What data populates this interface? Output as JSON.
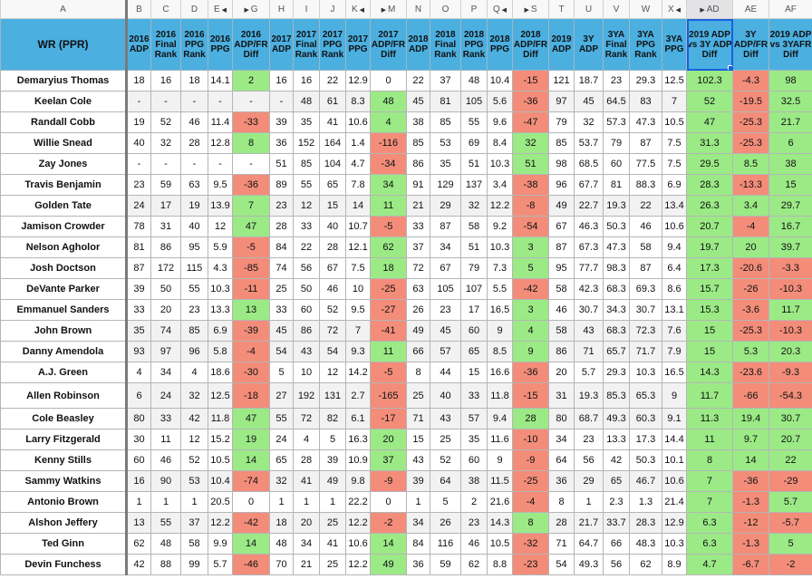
{
  "colors": {
    "header_bg": "#4bafe0",
    "positive": "#9bea86",
    "negative": "#f38d7a",
    "selection": "#1a5fe0"
  },
  "column_letters": [
    "A",
    "B",
    "C",
    "D",
    "E",
    "G",
    "H",
    "I",
    "J",
    "K",
    "M",
    "N",
    "O",
    "P",
    "Q",
    "S",
    "T",
    "U",
    "V",
    "W",
    "X",
    "AD",
    "AE",
    "AF"
  ],
  "hidden_column_markers": [
    "E",
    "G",
    "K",
    "M",
    "Q",
    "S",
    "X",
    "AD"
  ],
  "selected_cell": "AD",
  "headers": [
    "WR (PPR)",
    "2016 ADP",
    "2016 Final Rank",
    "2016 PPG Rank",
    "2016 PPG",
    "2016 ADP/FR Diff",
    "2017 ADP",
    "2017 Final Rank",
    "2017 PPG Rank",
    "2017 PPG",
    "2017 ADP/FR Diff",
    "2018 ADP",
    "2018 Final Rank",
    "2018 PPG Rank",
    "2018 PPG",
    "2018 ADP/FR Diff",
    "2019 ADP",
    "3Y ADP",
    "3YA Final Rank",
    "3YA PPG Rank",
    "3YA PPG",
    "2019 ADP vs 3Y ADP Diff",
    "3Y ADP/FR Diff",
    "2019 ADP vs 3YAFR Diff"
  ],
  "rows": [
    {
      "name": "Demaryius Thomas",
      "cells": [
        "18",
        "16",
        "18",
        "14.1",
        "2",
        "16",
        "16",
        "22",
        "12.9",
        "0",
        "22",
        "37",
        "48",
        "10.4",
        "-15",
        "121",
        "18.7",
        "23",
        "29.3",
        "12.5",
        "102.3",
        "-4.3",
        "98"
      ]
    },
    {
      "name": "Keelan Cole",
      "cells": [
        "-",
        "-",
        "-",
        "-",
        "-",
        "-",
        "48",
        "61",
        "8.3",
        "48",
        "45",
        "81",
        "105",
        "5.6",
        "-36",
        "97",
        "45",
        "64.5",
        "83",
        "7",
        "52",
        "-19.5",
        "32.5"
      ]
    },
    {
      "name": "Randall Cobb",
      "cells": [
        "19",
        "52",
        "46",
        "11.4",
        "-33",
        "39",
        "35",
        "41",
        "10.6",
        "4",
        "38",
        "85",
        "55",
        "9.6",
        "-47",
        "79",
        "32",
        "57.3",
        "47.3",
        "10.5",
        "47",
        "-25.3",
        "21.7"
      ]
    },
    {
      "name": "Willie Snead",
      "cells": [
        "40",
        "32",
        "28",
        "12.8",
        "8",
        "36",
        "152",
        "164",
        "1.4",
        "-116",
        "85",
        "53",
        "69",
        "8.4",
        "32",
        "85",
        "53.7",
        "79",
        "87",
        "7.5",
        "31.3",
        "-25.3",
        "6"
      ]
    },
    {
      "name": "Zay Jones",
      "cells": [
        "-",
        "-",
        "-",
        "-",
        "-",
        "51",
        "85",
        "104",
        "4.7",
        "-34",
        "86",
        "35",
        "51",
        "10.3",
        "51",
        "98",
        "68.5",
        "60",
        "77.5",
        "7.5",
        "29.5",
        "8.5",
        "38"
      ]
    },
    {
      "name": "Travis Benjamin",
      "cells": [
        "23",
        "59",
        "63",
        "9.5",
        "-36",
        "89",
        "55",
        "65",
        "7.8",
        "34",
        "91",
        "129",
        "137",
        "3.4",
        "-38",
        "96",
        "67.7",
        "81",
        "88.3",
        "6.9",
        "28.3",
        "-13.3",
        "15"
      ]
    },
    {
      "name": "Golden Tate",
      "cells": [
        "24",
        "17",
        "19",
        "13.9",
        "7",
        "23",
        "12",
        "15",
        "14",
        "11",
        "21",
        "29",
        "32",
        "12.2",
        "-8",
        "49",
        "22.7",
        "19.3",
        "22",
        "13.4",
        "26.3",
        "3.4",
        "29.7"
      ]
    },
    {
      "name": "Jamison Crowder",
      "cells": [
        "78",
        "31",
        "40",
        "12",
        "47",
        "28",
        "33",
        "40",
        "10.7",
        "-5",
        "33",
        "87",
        "58",
        "9.2",
        "-54",
        "67",
        "46.3",
        "50.3",
        "46",
        "10.6",
        "20.7",
        "-4",
        "16.7"
      ]
    },
    {
      "name": "Nelson Agholor",
      "cells": [
        "81",
        "86",
        "95",
        "5.9",
        "-5",
        "84",
        "22",
        "28",
        "12.1",
        "62",
        "37",
        "34",
        "51",
        "10.3",
        "3",
        "87",
        "67.3",
        "47.3",
        "58",
        "9.4",
        "19.7",
        "20",
        "39.7"
      ]
    },
    {
      "name": "Josh Doctson",
      "cells": [
        "87",
        "172",
        "115",
        "4.3",
        "-85",
        "74",
        "56",
        "67",
        "7.5",
        "18",
        "72",
        "67",
        "79",
        "7.3",
        "5",
        "95",
        "77.7",
        "98.3",
        "87",
        "6.4",
        "17.3",
        "-20.6",
        "-3.3"
      ]
    },
    {
      "name": "DeVante Parker",
      "cells": [
        "39",
        "50",
        "55",
        "10.3",
        "-11",
        "25",
        "50",
        "46",
        "10",
        "-25",
        "63",
        "105",
        "107",
        "5.5",
        "-42",
        "58",
        "42.3",
        "68.3",
        "69.3",
        "8.6",
        "15.7",
        "-26",
        "-10.3"
      ]
    },
    {
      "name": "Emmanuel Sanders",
      "cells": [
        "33",
        "20",
        "23",
        "13.3",
        "13",
        "33",
        "60",
        "52",
        "9.5",
        "-27",
        "26",
        "23",
        "17",
        "16.5",
        "3",
        "46",
        "30.7",
        "34.3",
        "30.7",
        "13.1",
        "15.3",
        "-3.6",
        "11.7"
      ]
    },
    {
      "name": "John Brown",
      "cells": [
        "35",
        "74",
        "85",
        "6.9",
        "-39",
        "45",
        "86",
        "72",
        "7",
        "-41",
        "49",
        "45",
        "60",
        "9",
        "4",
        "58",
        "43",
        "68.3",
        "72.3",
        "7.6",
        "15",
        "-25.3",
        "-10.3"
      ]
    },
    {
      "name": "Danny Amendola",
      "cells": [
        "93",
        "97",
        "96",
        "5.8",
        "-4",
        "54",
        "43",
        "54",
        "9.3",
        "11",
        "66",
        "57",
        "65",
        "8.5",
        "9",
        "86",
        "71",
        "65.7",
        "71.7",
        "7.9",
        "15",
        "5.3",
        "20.3"
      ]
    },
    {
      "name": "A.J. Green",
      "cells": [
        "4",
        "34",
        "4",
        "18.6",
        "-30",
        "5",
        "10",
        "12",
        "14.2",
        "-5",
        "8",
        "44",
        "15",
        "16.6",
        "-36",
        "20",
        "5.7",
        "29.3",
        "10.3",
        "16.5",
        "14.3",
        "-23.6",
        "-9.3"
      ]
    },
    {
      "name": "Allen Robinson",
      "cells": [
        "6",
        "24",
        "32",
        "12.5",
        "-18",
        "27",
        "192",
        "131",
        "2.7",
        "-165",
        "25",
        "40",
        "33",
        "11.8",
        "-15",
        "31",
        "19.3",
        "85.3",
        "65.3",
        "9",
        "11.7",
        "-66",
        "-54.3"
      ]
    },
    {
      "name": "Cole Beasley",
      "cells": [
        "80",
        "33",
        "42",
        "11.8",
        "47",
        "55",
        "72",
        "82",
        "6.1",
        "-17",
        "71",
        "43",
        "57",
        "9.4",
        "28",
        "80",
        "68.7",
        "49.3",
        "60.3",
        "9.1",
        "11.3",
        "19.4",
        "30.7"
      ]
    },
    {
      "name": "Larry Fitzgerald",
      "cells": [
        "30",
        "11",
        "12",
        "15.2",
        "19",
        "24",
        "4",
        "5",
        "16.3",
        "20",
        "15",
        "25",
        "35",
        "11.6",
        "-10",
        "34",
        "23",
        "13.3",
        "17.3",
        "14.4",
        "11",
        "9.7",
        "20.7"
      ]
    },
    {
      "name": "Kenny Stills",
      "cells": [
        "60",
        "46",
        "52",
        "10.5",
        "14",
        "65",
        "28",
        "39",
        "10.9",
        "37",
        "43",
        "52",
        "60",
        "9",
        "-9",
        "64",
        "56",
        "42",
        "50.3",
        "10.1",
        "8",
        "14",
        "22"
      ]
    },
    {
      "name": "Sammy Watkins",
      "cells": [
        "16",
        "90",
        "53",
        "10.4",
        "-74",
        "32",
        "41",
        "49",
        "9.8",
        "-9",
        "39",
        "64",
        "38",
        "11.5",
        "-25",
        "36",
        "29",
        "65",
        "46.7",
        "10.6",
        "7",
        "-36",
        "-29"
      ]
    },
    {
      "name": "Antonio Brown",
      "cells": [
        "1",
        "1",
        "1",
        "20.5",
        "0",
        "1",
        "1",
        "1",
        "22.2",
        "0",
        "1",
        "5",
        "2",
        "21.6",
        "-4",
        "8",
        "1",
        "2.3",
        "1.3",
        "21.4",
        "7",
        "-1.3",
        "5.7"
      ]
    },
    {
      "name": "Alshon Jeffery",
      "cells": [
        "13",
        "55",
        "37",
        "12.2",
        "-42",
        "18",
        "20",
        "25",
        "12.2",
        "-2",
        "34",
        "26",
        "23",
        "14.3",
        "8",
        "28",
        "21.7",
        "33.7",
        "28.3",
        "12.9",
        "6.3",
        "-12",
        "-5.7"
      ]
    },
    {
      "name": "Ted Ginn",
      "cells": [
        "62",
        "48",
        "58",
        "9.9",
        "14",
        "48",
        "34",
        "41",
        "10.6",
        "14",
        "84",
        "116",
        "46",
        "10.5",
        "-32",
        "71",
        "64.7",
        "66",
        "48.3",
        "10.3",
        "6.3",
        "-1.3",
        "5"
      ]
    },
    {
      "name": "Devin Funchess",
      "cells": [
        "42",
        "88",
        "99",
        "5.7",
        "-46",
        "70",
        "21",
        "25",
        "12.2",
        "49",
        "36",
        "59",
        "62",
        "8.8",
        "-23",
        "54",
        "49.3",
        "56",
        "62",
        "8.9",
        "4.7",
        "-6.7",
        "-2"
      ]
    }
  ]
}
